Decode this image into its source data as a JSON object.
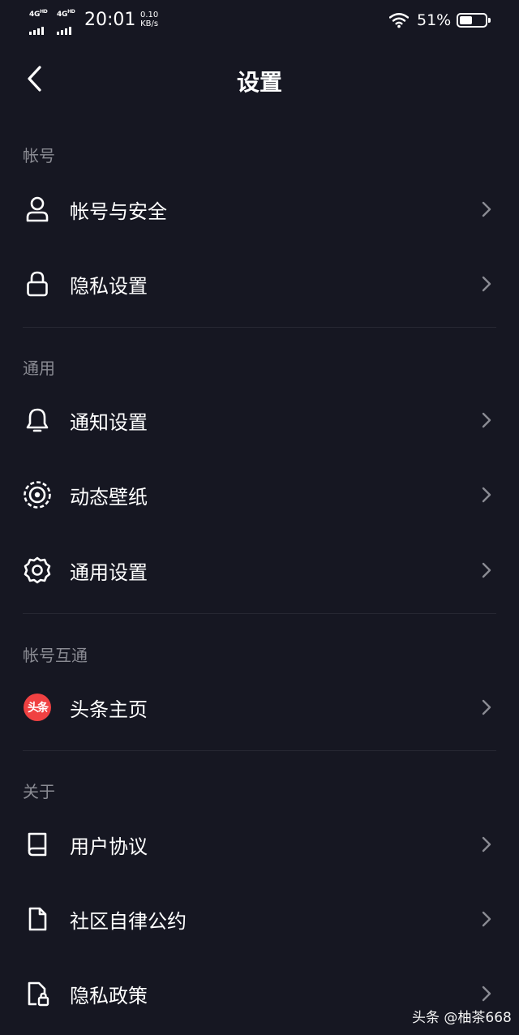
{
  "status_bar": {
    "network_1": "4G",
    "network_1_sup": "HD",
    "network_2": "4G",
    "network_2_sup": "HD",
    "time": "20:01",
    "speed_value": "0.10",
    "speed_unit": "KB/s",
    "battery": "51%",
    "battery_level": 0.51
  },
  "header": {
    "title": "设置"
  },
  "sections": {
    "account": {
      "title": "帐号",
      "items": [
        {
          "label": "帐号与安全",
          "icon": "user-icon"
        },
        {
          "label": "隐私设置",
          "icon": "lock-icon"
        }
      ]
    },
    "general": {
      "title": "通用",
      "items": [
        {
          "label": "通知设置",
          "icon": "bell-icon"
        },
        {
          "label": "动态壁纸",
          "icon": "live-wallpaper-icon"
        },
        {
          "label": "通用设置",
          "icon": "gear-icon"
        }
      ]
    },
    "linked": {
      "title": "帐号互通",
      "items": [
        {
          "label": "头条主页",
          "icon": "toutiao-logo-icon",
          "badge": "头条"
        }
      ]
    },
    "about": {
      "title": "关于",
      "items": [
        {
          "label": "用户协议",
          "icon": "book-icon"
        },
        {
          "label": "社区自律公约",
          "icon": "document-icon"
        },
        {
          "label": "隐私政策",
          "icon": "privacy-document-icon"
        }
      ]
    }
  },
  "watermark": "头条 @柚茶668",
  "colors": {
    "background": "#161722",
    "section_header": "#8a8b93",
    "divider": "#272833",
    "toutiao_red": "#f04142"
  }
}
